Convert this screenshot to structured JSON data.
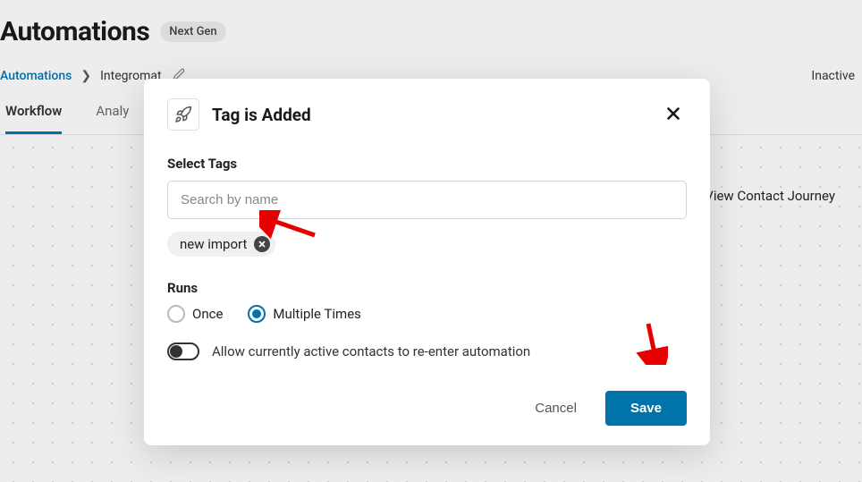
{
  "header": {
    "title": "Automations",
    "badge": "Next Gen"
  },
  "breadcrumb": {
    "link": "Automations",
    "current": "Integromat"
  },
  "status": "Inactive",
  "tabs": [
    {
      "label": "Workflow",
      "active": true
    },
    {
      "label": "Analy",
      "active": false
    }
  ],
  "journey_link": "View Contact Journey",
  "modal": {
    "title": "Tag is Added",
    "select_tags_label": "Select Tags",
    "search_placeholder": "Search by name",
    "selected_tag": "new import",
    "runs_label": "Runs",
    "runs_options": {
      "once": "Once",
      "multiple": "Multiple Times"
    },
    "runs_selected": "multiple",
    "toggle_label": "Allow currently active contacts to re-enter automation",
    "toggle_on": false,
    "cancel_label": "Cancel",
    "save_label": "Save"
  }
}
